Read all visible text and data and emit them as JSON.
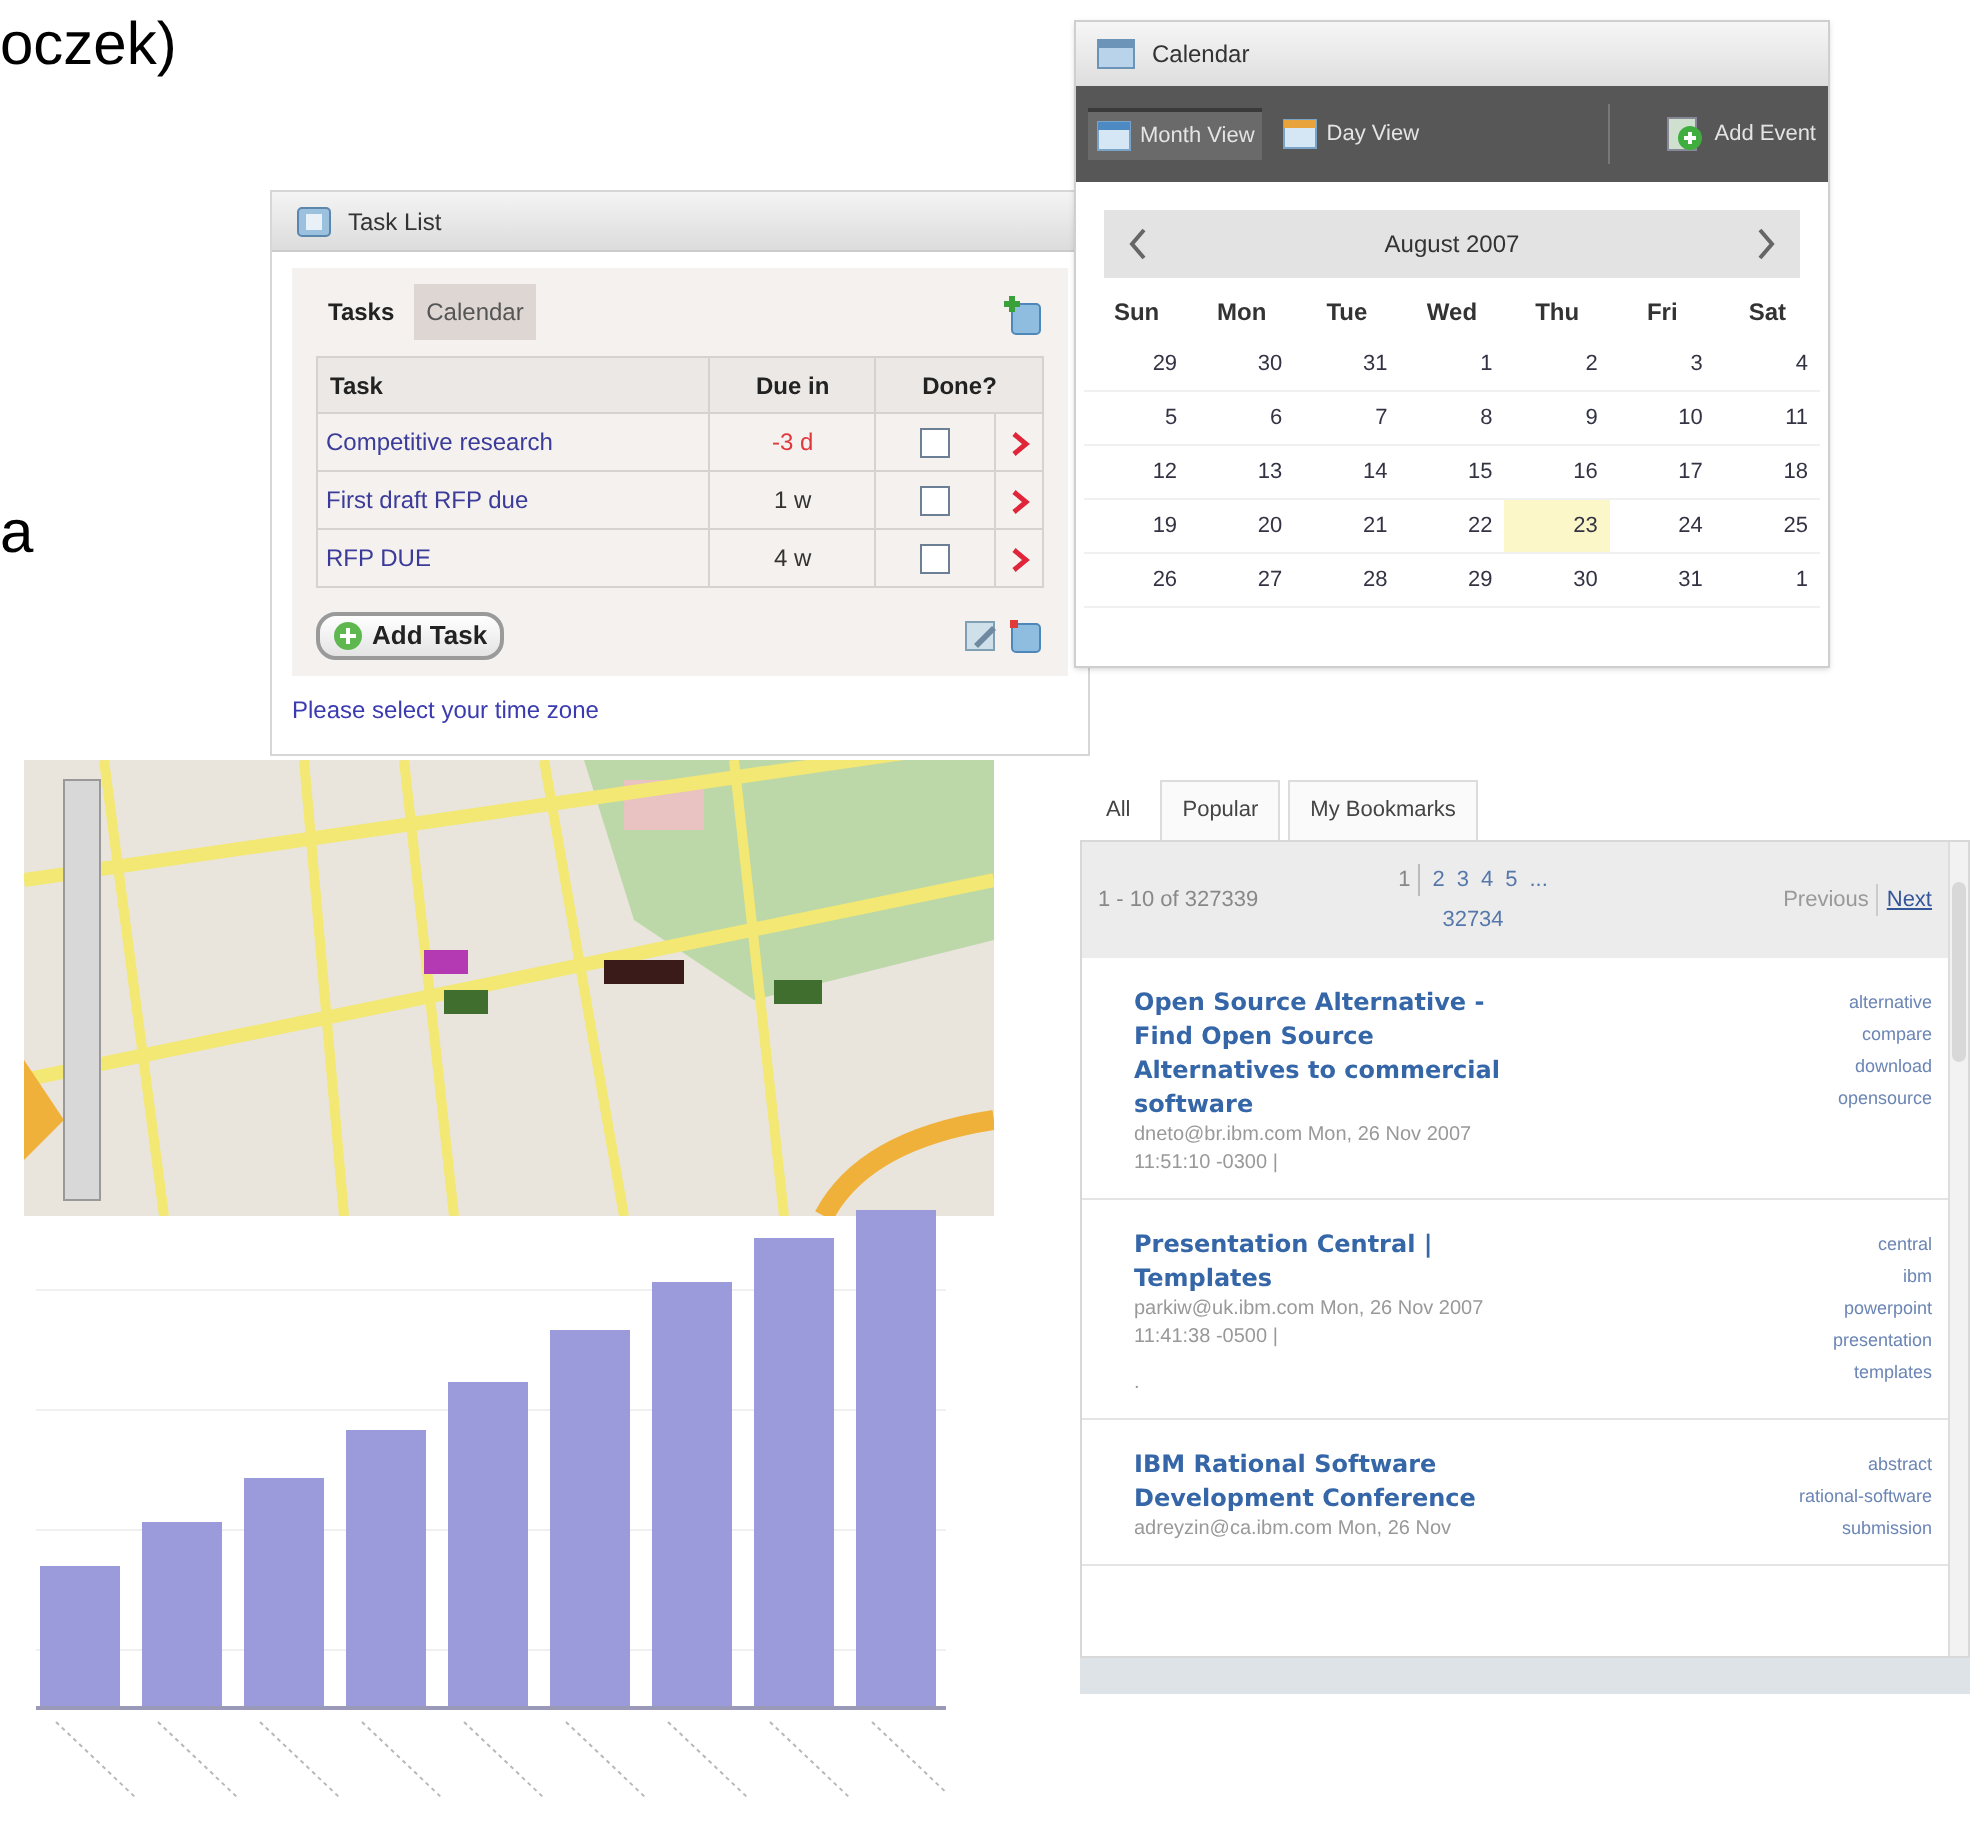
{
  "slide": {
    "heading_fragment": "oczek)",
    "text_fragment": "a"
  },
  "task_list": {
    "title": "Task List",
    "tabs": [
      {
        "label": "Tasks",
        "selected": true
      },
      {
        "label": "Calendar",
        "selected": false
      }
    ],
    "columns": [
      "Task",
      "Due in",
      "Done?"
    ],
    "rows": [
      {
        "task": "Competitive research",
        "due": "-3 d",
        "overdue": true,
        "done": false
      },
      {
        "task": "First draft RFP due",
        "due": "1 w",
        "overdue": false,
        "done": false
      },
      {
        "task": "RFP DUE",
        "due": "4 w",
        "overdue": false,
        "done": false
      }
    ],
    "add_button": "Add Task",
    "footer_link": "Please select your time zone"
  },
  "calendar": {
    "title": "Calendar",
    "views": [
      {
        "label": "Month View",
        "selected": true
      },
      {
        "label": "Day View",
        "selected": false
      }
    ],
    "add_event": "Add Event",
    "month": "August 2007",
    "weekdays": [
      "Sun",
      "Mon",
      "Tue",
      "Wed",
      "Thu",
      "Fri",
      "Sat"
    ],
    "weeks": [
      [
        {
          "day": "29",
          "selected": false
        },
        {
          "day": "30",
          "selected": false
        },
        {
          "day": "31",
          "selected": false
        },
        {
          "day": "1",
          "selected": false
        },
        {
          "day": "2",
          "selected": false
        },
        {
          "day": "3",
          "selected": false
        },
        {
          "day": "4",
          "selected": false
        }
      ],
      [
        {
          "day": "5",
          "selected": false
        },
        {
          "day": "6",
          "selected": false
        },
        {
          "day": "7",
          "selected": false
        },
        {
          "day": "8",
          "selected": false
        },
        {
          "day": "9",
          "selected": false
        },
        {
          "day": "10",
          "selected": false
        },
        {
          "day": "11",
          "selected": false
        }
      ],
      [
        {
          "day": "12",
          "selected": false
        },
        {
          "day": "13",
          "selected": false
        },
        {
          "day": "14",
          "selected": false
        },
        {
          "day": "15",
          "selected": false
        },
        {
          "day": "16",
          "selected": false
        },
        {
          "day": "17",
          "selected": false
        },
        {
          "day": "18",
          "selected": false
        }
      ],
      [
        {
          "day": "19",
          "selected": false
        },
        {
          "day": "20",
          "selected": false
        },
        {
          "day": "21",
          "selected": false
        },
        {
          "day": "22",
          "selected": false
        },
        {
          "day": "23",
          "selected": true
        },
        {
          "day": "24",
          "selected": false
        },
        {
          "day": "25",
          "selected": false
        }
      ],
      [
        {
          "day": "26",
          "selected": false
        },
        {
          "day": "27",
          "selected": false
        },
        {
          "day": "28",
          "selected": false
        },
        {
          "day": "29",
          "selected": false
        },
        {
          "day": "30",
          "selected": false
        },
        {
          "day": "31",
          "selected": false
        },
        {
          "day": "1",
          "selected": false
        }
      ]
    ]
  },
  "bookmarks": {
    "tabs": [
      {
        "label": "All",
        "selected": true
      },
      {
        "label": "Popular",
        "selected": false
      },
      {
        "label": "My Bookmarks",
        "selected": false
      }
    ],
    "range": "1 - 10 of 327339",
    "pages": [
      {
        "label": "1",
        "selected": true
      },
      {
        "label": "2",
        "selected": false
      },
      {
        "label": "3",
        "selected": false
      },
      {
        "label": "4",
        "selected": false
      },
      {
        "label": "5",
        "selected": false
      },
      {
        "label": "...",
        "selected": false
      },
      {
        "label": "32734",
        "selected": false
      }
    ],
    "previous": "Previous",
    "next": "Next",
    "items": [
      {
        "title": "Open Source Alternative - Find Open Source Alternatives to commercial software",
        "meta": "dneto@br.ibm.com Mon, 26 Nov 2007 11:51:10 -0300  |",
        "tags": [
          "alternative",
          "compare",
          "download",
          "opensource"
        ]
      },
      {
        "title": "Presentation Central | Templates",
        "meta": "parkiw@uk.ibm.com Mon, 26 Nov 2007 11:41:38 -0500  |",
        "note": ".",
        "tags": [
          "central",
          "ibm",
          "powerpoint",
          "presentation",
          "templates"
        ]
      },
      {
        "title": "IBM Rational Software Development Conference",
        "meta": "adreyzin@ca.ibm.com Mon, 26 Nov",
        "tags": [
          "abstract",
          "rational-software",
          "submission"
        ]
      }
    ]
  }
}
